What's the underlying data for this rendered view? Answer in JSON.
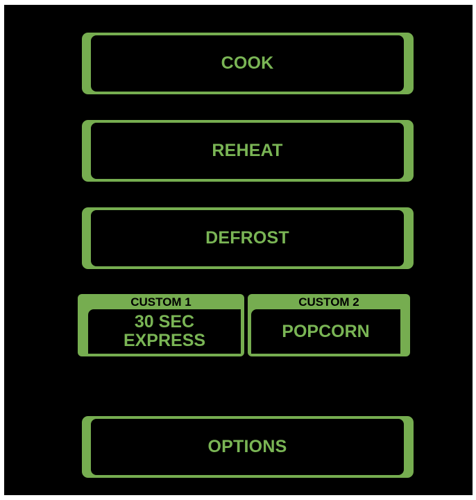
{
  "colors": {
    "panel_background": "#000000",
    "accent_green": "#76ad50",
    "label_green": "#7ab555"
  },
  "menu": {
    "cook_label": "COOK",
    "reheat_label": "REHEAT",
    "defrost_label": "DEFROST",
    "options_label": "OPTIONS"
  },
  "custom": [
    {
      "header": "CUSTOM 1",
      "line1": "30 SEC",
      "line2": "EXPRESS"
    },
    {
      "header": "CUSTOM 2",
      "line1": "POPCORN"
    }
  ]
}
